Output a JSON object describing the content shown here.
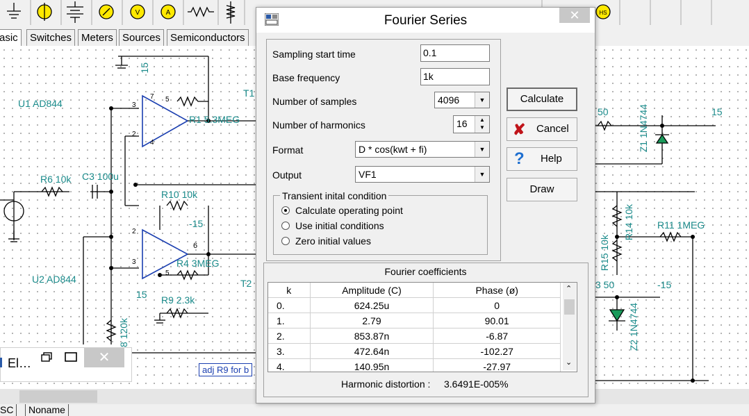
{
  "palette_tabs": [
    "asic",
    "Switches",
    "Meters",
    "Sources",
    "Semiconductors"
  ],
  "schematic": {
    "labels": [
      "U1 AD844",
      "R1 5.3MEG",
      "T1",
      "R6 10k",
      "C3 100u",
      "R10 10k",
      "-15",
      "R4 3MEG",
      "6",
      "U2 AD844",
      "15",
      "R9 2.3k",
      "T2",
      "8 120k",
      "15",
      "50",
      "15",
      "Z1 1N4744",
      "R14 10k",
      "R11 1MEG",
      "R15 10k",
      "3 50",
      "-15",
      "Z2 1N4744",
      "3",
      "2",
      "5",
      "2",
      "3",
      "5",
      "7",
      "4"
    ],
    "note": "adj R9 for b"
  },
  "mini_window": {
    "title": "El…"
  },
  "bottom_tabs": [
    "SC",
    "Noname"
  ],
  "dialog": {
    "title": "Fourier Series",
    "fields": {
      "sampling_start_time": {
        "label": "Sampling start time",
        "value": "0.1"
      },
      "base_frequency": {
        "label": "Base frequency",
        "value": "1k"
      },
      "number_of_samples": {
        "label": "Number of samples",
        "value": "4096"
      },
      "number_of_harmonics": {
        "label": "Number of harmonics",
        "value": "16"
      },
      "format": {
        "label": "Format",
        "value": "D * cos(kwt + fi)"
      },
      "output": {
        "label": "Output",
        "value": "VF1"
      }
    },
    "transient": {
      "title": "Transient inital condition",
      "options": [
        "Calculate operating point",
        "Use initial conditions",
        "Zero initial values"
      ],
      "selected": 0
    },
    "buttons": {
      "calculate": "Calculate",
      "cancel": "Cancel",
      "help": "Help",
      "draw": "Draw"
    },
    "coefficients": {
      "title": "Fourier coefficients",
      "columns": [
        "k",
        "Amplitude (C)",
        "Phase (ø)"
      ],
      "rows": [
        [
          "0.",
          "624.25u",
          "0"
        ],
        [
          "1.",
          "2.79",
          "90.01"
        ],
        [
          "2.",
          "853.87n",
          "-6.87"
        ],
        [
          "3.",
          "472.64n",
          "-102.27"
        ],
        [
          "4.",
          "140.95n",
          "-27.97"
        ]
      ]
    },
    "distortion": {
      "label": "Harmonic distortion :",
      "value": "3.6491E-005%"
    }
  }
}
